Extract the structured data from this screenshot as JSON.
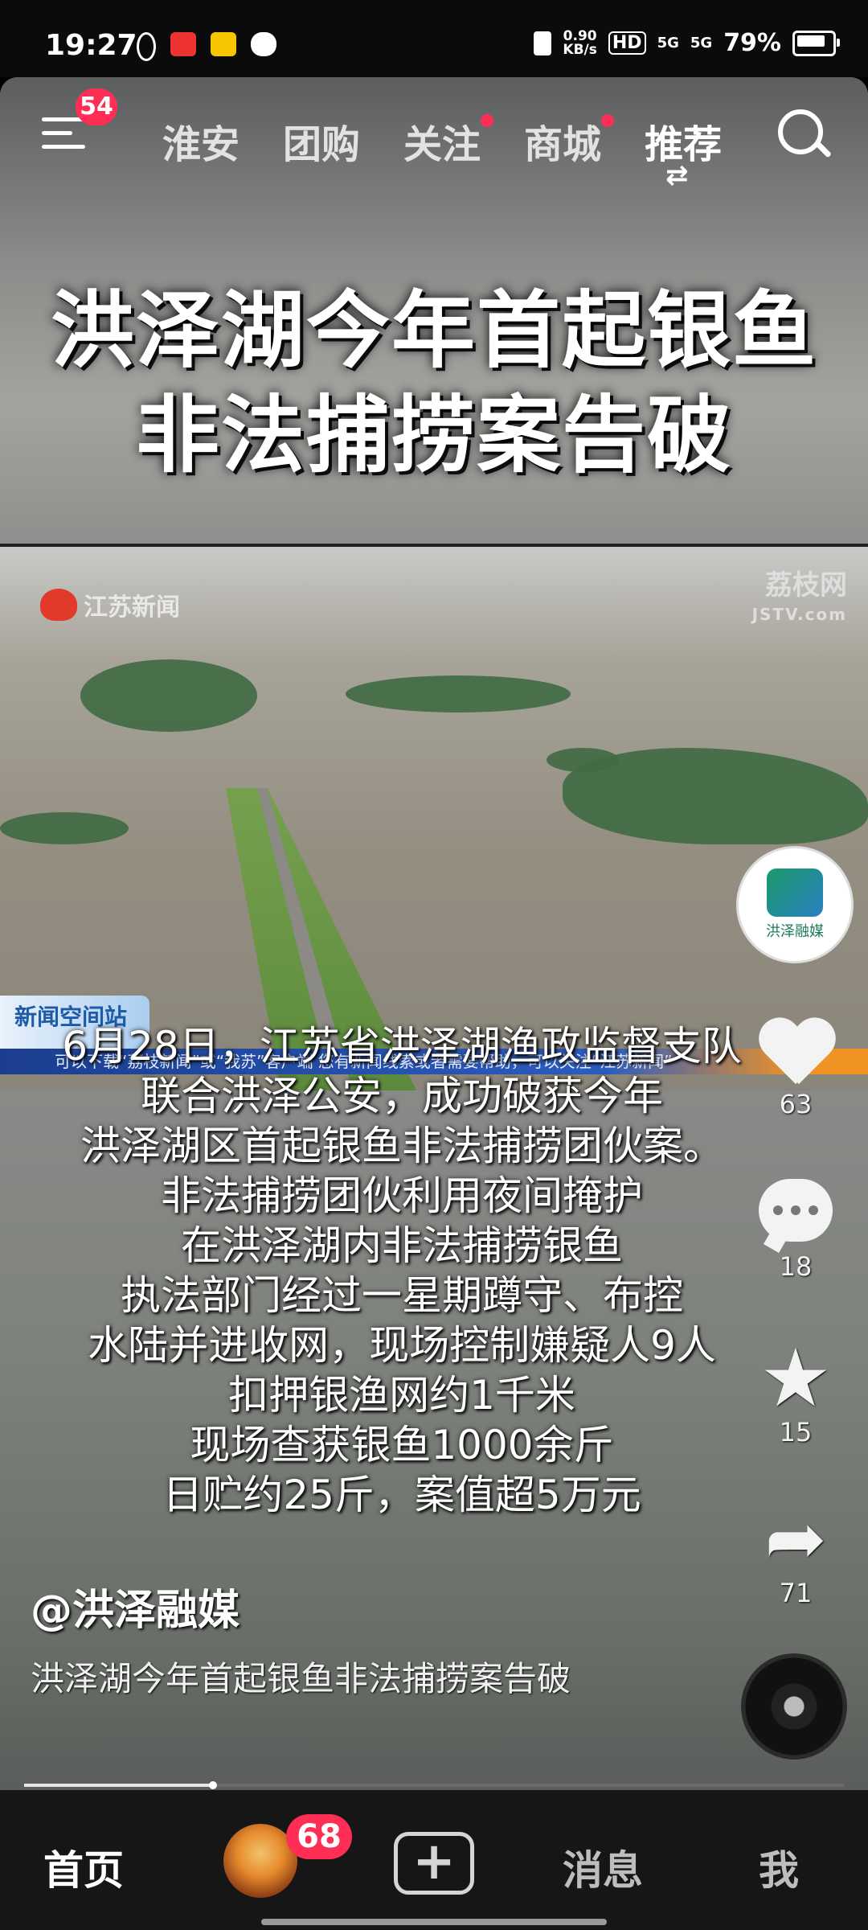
{
  "status_bar": {
    "time": "19:27",
    "net_speed_value": "0.90",
    "net_speed_unit": "KB/s",
    "hd_label": "HD",
    "signal1": "5G",
    "signal2": "5G",
    "battery": "79%"
  },
  "top_nav": {
    "menu_badge": "54",
    "tabs": [
      {
        "label": "淮安"
      },
      {
        "label": "团购"
      },
      {
        "label": "关注"
      },
      {
        "label": "商城"
      },
      {
        "label": "推荐"
      }
    ]
  },
  "video": {
    "headline_line1": "洪泽湖今年首起银鱼",
    "headline_line2": "非法捕捞案告破",
    "news_logo_left": "江苏新闻",
    "news_logo_right": "荔枝网",
    "news_logo_right_sub": "JSTV.com",
    "news_station": "新闻空间站",
    "ticker": "可以下载“荔枝新闻”或“我苏”客户端    您有新闻线索或者需要帮助，可以关注“江苏新闻”",
    "caption_lines": [
      "6月28日，江苏省洪泽湖渔政监督支队",
      "联合洪泽公安，成功破获今年",
      "洪泽湖区首起银鱼非法捕捞团伙案。",
      "非法捕捞团伙利用夜间掩护",
      "在洪泽湖内非法捕捞银鱼",
      "执法部门经过一星期蹲守、布控",
      "水陆并进收网，现场控制嫌疑人9人",
      "扣押银渔网约1千米",
      "现场查获银鱼1000余斤",
      "日贮约25斤，案值超5万元"
    ],
    "author": "@洪泽融媒",
    "title": "洪泽湖今年首起银鱼非法捕捞案告破",
    "progress": 0.23
  },
  "right_rail": {
    "avatar_text": "洪泽融媒",
    "likes": "63",
    "comments": "18",
    "favorites": "15",
    "shares": "71"
  },
  "bottom_nav": {
    "home": "首页",
    "badge": "68",
    "plus": "+",
    "messages": "消息",
    "me": "我"
  }
}
